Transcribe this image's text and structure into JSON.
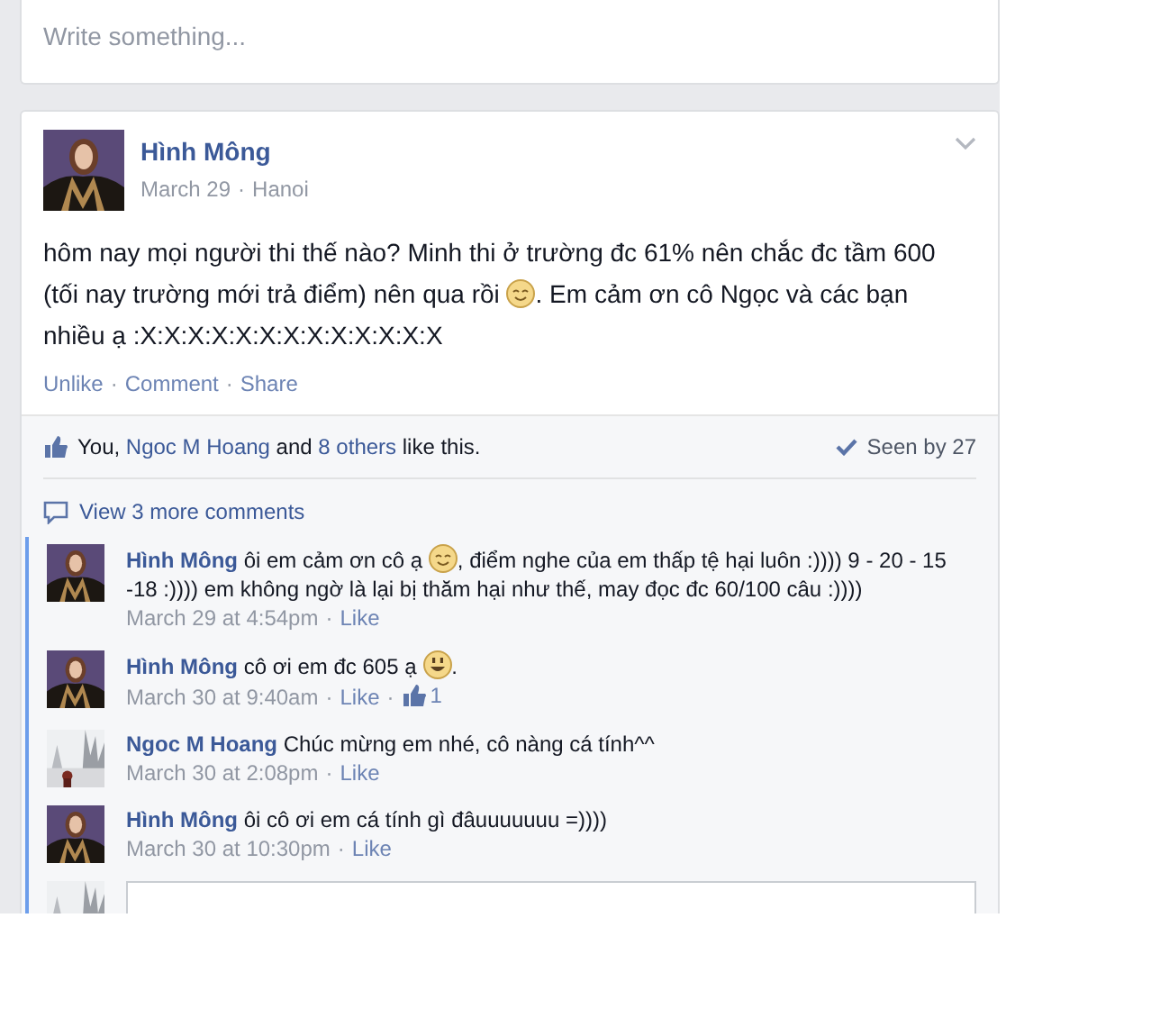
{
  "composer": {
    "placeholder": "Write something..."
  },
  "post": {
    "author": "Hình Mông",
    "meta": [
      {
        "kind": "link",
        "text": "March 29"
      },
      {
        "kind": "dot",
        "text": "·"
      },
      {
        "kind": "link",
        "text": "Hanoi"
      }
    ],
    "body": [
      {
        "kind": "text",
        "text": "hôm nay mọi người thi thế nào? Minh thi ở trường đc 61% nên chắc đc tầm 600 (tối nay trường mới trả điểm) nên qua rồi "
      },
      {
        "kind": "emoji"
      },
      {
        "kind": "text",
        "text": ". Em cảm ơn cô Ngọc và các bạn nhiều ạ :X:X:X:X:X:X:X:X:X:X:X:X:X"
      }
    ],
    "actions": [
      {
        "kind": "link",
        "text": "Unlike"
      },
      {
        "kind": "dot",
        "text": "·"
      },
      {
        "kind": "link",
        "text": "Comment"
      },
      {
        "kind": "dot",
        "text": "·"
      },
      {
        "kind": "link",
        "text": "Share"
      }
    ],
    "likes": {
      "you": "You,",
      "friend": "Ngoc M Hoang",
      "and": "and",
      "others": "8 others",
      "tail": "like this."
    },
    "seen": "Seen by 27",
    "view_more": "View 3 more comments",
    "comments": [
      {
        "kind": "portrait",
        "author": "Hình Mông",
        "body": [
          {
            "kind": "text",
            "text": "ôi em cảm ơn cô ạ "
          },
          {
            "kind": "emoji"
          },
          {
            "kind": "text",
            "text": ", điểm nghe của em thấp tệ hại luôn :)))) 9 - 20 - 15 -18 :)))) em không ngờ là lại bị thăm hại như thế, may đọc đc 60/100 câu :))))"
          }
        ],
        "meta": [
          {
            "kind": "time",
            "text": "March 29 at 4:54pm"
          },
          {
            "kind": "dot",
            "text": "·"
          },
          {
            "kind": "link",
            "text": "Like"
          }
        ]
      },
      {
        "kind": "portrait",
        "author": "Hình Mông",
        "body": [
          {
            "kind": "text",
            "text": "cô ơi em đc 605 ạ "
          },
          {
            "kind": "grin"
          },
          {
            "kind": "text",
            "text": "."
          }
        ],
        "meta": [
          {
            "kind": "time",
            "text": "March 30 at 9:40am"
          },
          {
            "kind": "dot",
            "text": "·"
          },
          {
            "kind": "link",
            "text": "Like"
          },
          {
            "kind": "dot",
            "text": "·"
          },
          {
            "kind": "likes",
            "text": "1"
          }
        ]
      },
      {
        "kind": "picture",
        "author": "Ngoc M Hoang",
        "body": [
          {
            "kind": "text",
            "text": "Chúc mừng em nhé, cô nàng cá tính^^"
          }
        ],
        "meta": [
          {
            "kind": "time",
            "text": "March 30 at 2:08pm"
          },
          {
            "kind": "dot",
            "text": "·"
          },
          {
            "kind": "link",
            "text": "Like"
          }
        ]
      },
      {
        "kind": "portrait",
        "author": "Hình Mông",
        "body": [
          {
            "kind": "text",
            "text": "ôi cô ơi em cá tính gì đâuuuuuuu =))))"
          }
        ],
        "meta": [
          {
            "kind": "time",
            "text": "March 30 at 10:30pm"
          },
          {
            "kind": "dot",
            "text": "·"
          },
          {
            "kind": "link",
            "text": "Like"
          }
        ]
      }
    ]
  }
}
